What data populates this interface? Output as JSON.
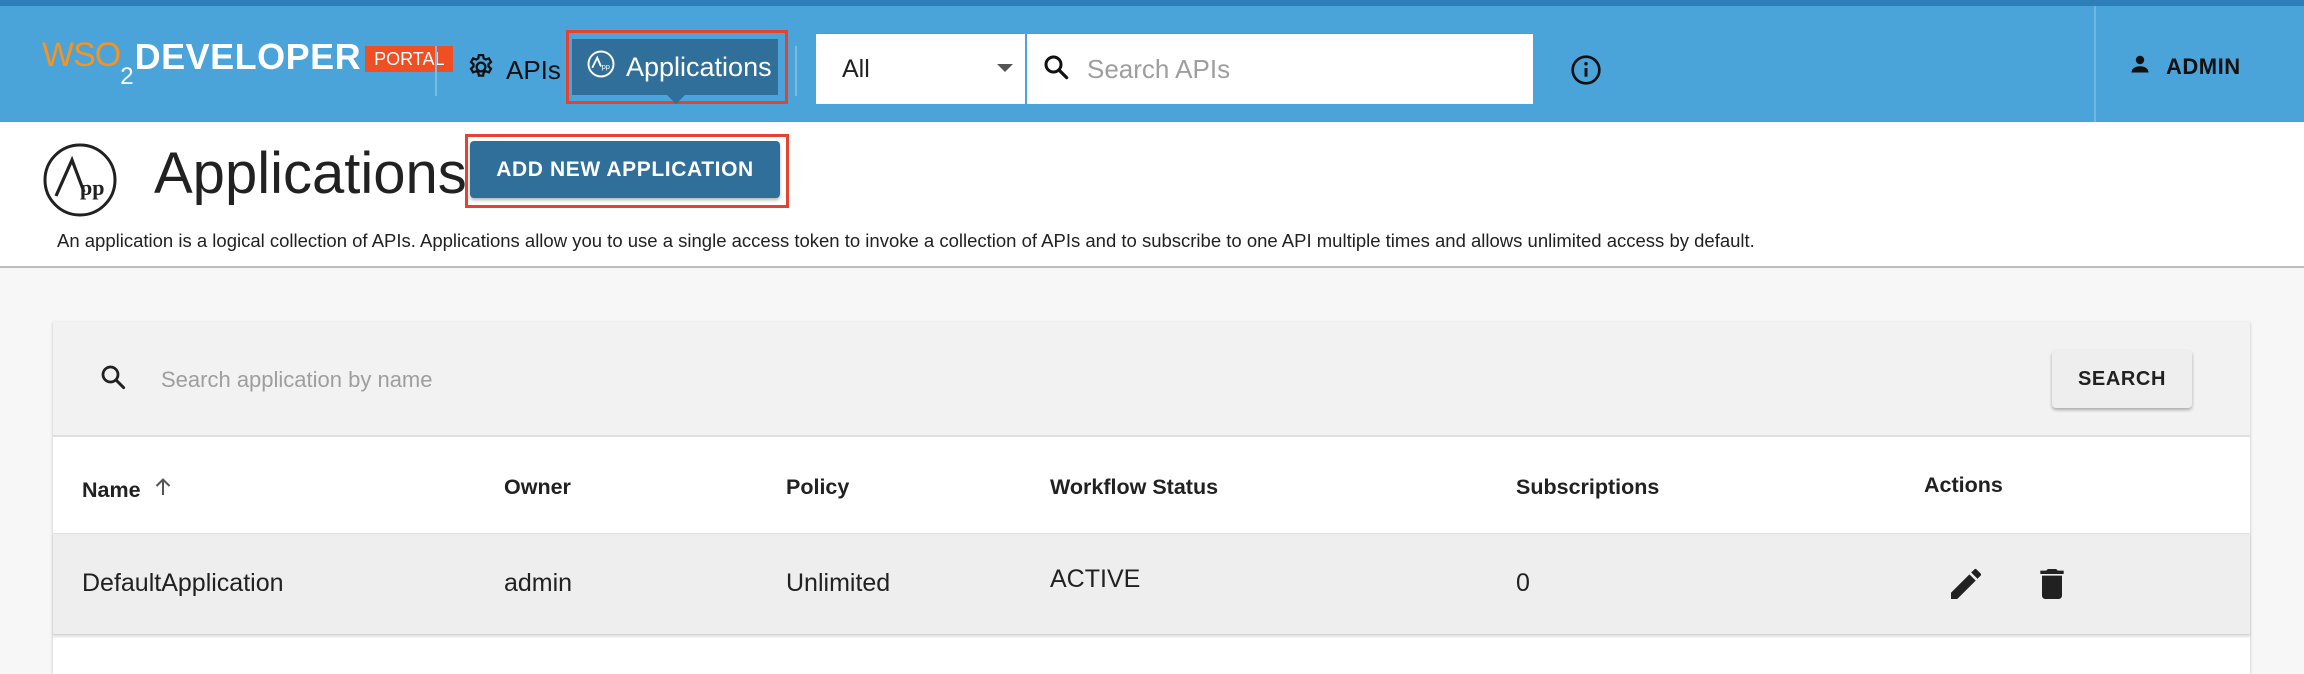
{
  "header": {
    "logo": {
      "wso": "WSO",
      "two": "2",
      "developer": "DEVELOPER",
      "portal_badge": "PORTAL"
    },
    "nav": [
      {
        "label": "APIs",
        "icon": "gear-icon"
      },
      {
        "label": "Applications",
        "icon": "applications-icon",
        "active": true
      }
    ],
    "filter_select": {
      "value": "All"
    },
    "search": {
      "placeholder": "Search APIs",
      "value": ""
    },
    "info_icon": "info-icon",
    "user": {
      "label": "ADMIN",
      "icon": "person-icon"
    },
    "colors": {
      "bar": "#4aa3d9",
      "active_nav": "#2f6f99",
      "highlight": "#e4432f",
      "logo_orange": "#f7931e",
      "portal_badge": "#f04e23"
    }
  },
  "page": {
    "title": "Applications",
    "logo_text": "App",
    "add_button": "ADD NEW APPLICATION",
    "description": "An application is a logical collection of APIs. Applications allow you to use a single access token to invoke a collection of APIs and to subscribe to one API multiple times and allows unlimited access by default."
  },
  "table": {
    "search": {
      "placeholder": "Search application by name",
      "value": "",
      "button": "SEARCH"
    },
    "columns": [
      "Name",
      "Owner",
      "Policy",
      "Workflow Status",
      "Subscriptions",
      "Actions"
    ],
    "sort": {
      "column": "Name",
      "direction": "ascending"
    },
    "rows": [
      {
        "name": "DefaultApplication",
        "owner": "admin",
        "policy": "Unlimited",
        "workflow_status": "ACTIVE",
        "subscriptions": "0",
        "actions": [
          "edit-icon",
          "delete-icon"
        ]
      }
    ]
  }
}
